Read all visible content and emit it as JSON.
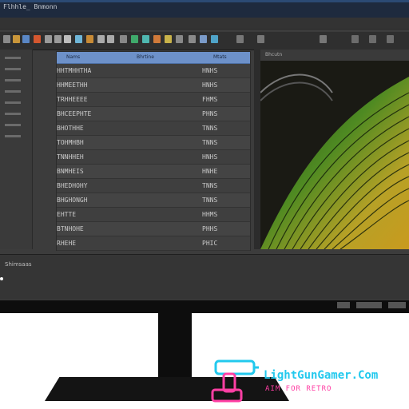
{
  "window": {
    "title": "Flhhle_ Bnmonn"
  },
  "table": {
    "columns": [
      "Nams",
      "Bhrtine",
      "Mtats"
    ],
    "rows": [
      {
        "name": "HHTMHHTHA",
        "value": "HNHS"
      },
      {
        "name": "HHMEETHH",
        "value": "HNHS"
      },
      {
        "name": "TRHHEEEE",
        "value": "FHMS"
      },
      {
        "name": "BHCEEPHTE",
        "value": "PHNS"
      },
      {
        "name": "BHOTHHE",
        "value": "TNNS"
      },
      {
        "name": "TOHMHBH",
        "value": "TNNS"
      },
      {
        "name": "TNNHHEH",
        "value": "HNHS"
      },
      {
        "name": "BNMHEIS",
        "value": "HNHE"
      },
      {
        "name": "BHEDHOHY",
        "value": "TNNS"
      },
      {
        "name": "BHGHONGH",
        "value": "TNNS"
      },
      {
        "name": "EHTTE",
        "value": "HHMS"
      },
      {
        "name": "BTNHOHE",
        "value": "PHHS"
      },
      {
        "name": "RHEHE",
        "value": "PHIC"
      }
    ]
  },
  "sidebar": {
    "items": [
      "",
      "",
      "",
      "",
      "",
      "",
      "",
      "",
      "",
      ""
    ]
  },
  "preview": {
    "label": "Bhcutn"
  },
  "bottom_panel": {
    "label": "Shimsaas"
  },
  "watermark": {
    "title": "LightGunGamer.Com",
    "subtitle": "AIM FOR RETRO"
  },
  "colors": {
    "table_header": "#6d91c9",
    "titlebar": "#1e2a3e",
    "watermark_cyan": "#22c9ee",
    "watermark_pink": "#ff3fa4"
  }
}
